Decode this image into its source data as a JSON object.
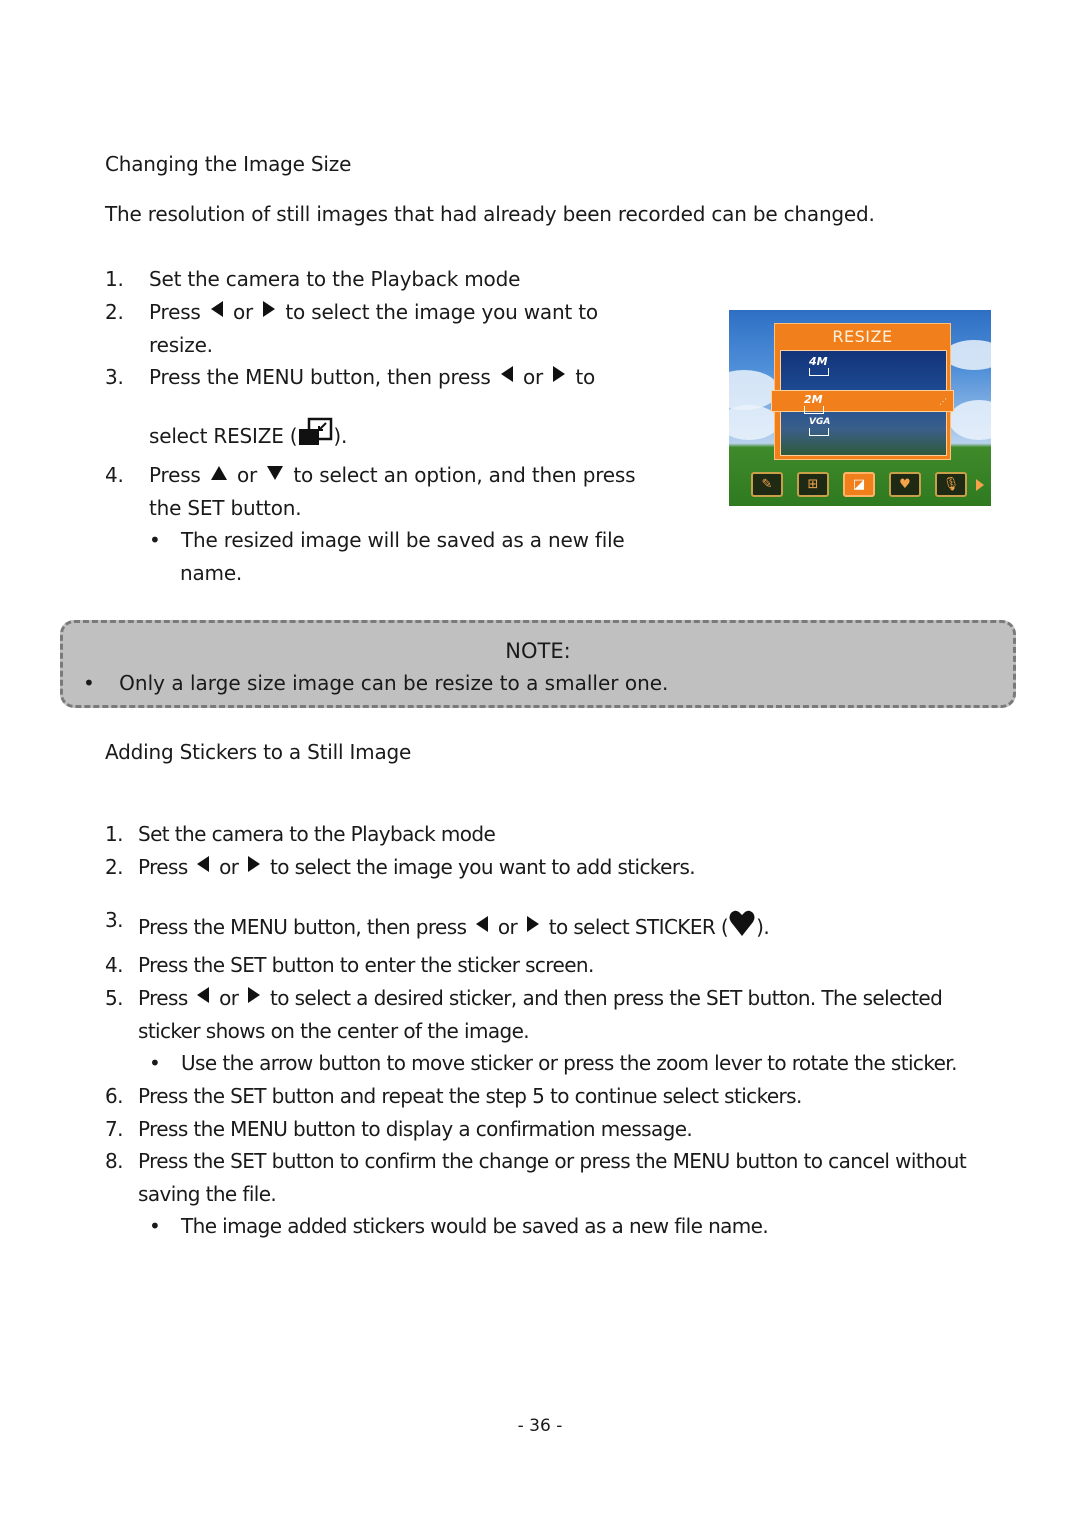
{
  "section1": {
    "heading": "Changing the Image Size",
    "intro": "The resolution of still images that had already been recorded can be changed.",
    "steps": [
      {
        "num": "1.",
        "text": "Set the camera to the Playback mode"
      },
      {
        "num": "2.",
        "pre": "Press",
        "or": "or",
        "post": "to select the image you want to",
        "cont": "resize."
      },
      {
        "num": "3.",
        "pre": "Press the MENU button, then press",
        "or": "or",
        "post": "to",
        "cont_pre": "select RESIZE (",
        "cont_post": ")."
      },
      {
        "num": "4.",
        "pre": "Press",
        "or": "or",
        "post": "to select an option, and then press",
        "cont": "the SET button."
      }
    ],
    "bullet": {
      "symbol": "•",
      "line1": "The resized image will be saved as a new file",
      "line2": "name."
    }
  },
  "camera_screen": {
    "menu_title": "RESIZE",
    "options": [
      "4M",
      "2M",
      "VGA"
    ],
    "selected_option": "2M",
    "icons": [
      "effect-icon",
      "rotate-icon",
      "resize-icon",
      "sticker-icon",
      "voice-memo-icon"
    ],
    "selected_icon": "resize-icon",
    "accent_color": "#f07f1c"
  },
  "note": {
    "title": "NOTE:",
    "bullet": "•",
    "text": "Only a large size image can be resize to a smaller one."
  },
  "section2": {
    "heading": "Adding Stickers to a Still Image",
    "steps": [
      {
        "num": "1.",
        "text": "Set the camera to the Playback mode"
      },
      {
        "num": "2.",
        "pre": "Press",
        "or": "or",
        "post": "to select the image you want to add stickers."
      },
      {
        "num": "3.",
        "pre": "Press the MENU button, then press",
        "or": "or",
        "post": "to select STICKER (",
        "end": ")."
      },
      {
        "num": "4.",
        "text": "Press the SET button to enter the sticker screen."
      },
      {
        "num": "5.",
        "pre": "Press",
        "or": "or",
        "post": "to select a desired sticker, and then press the SET button. The selected",
        "cont": "sticker shows on the center of the image."
      },
      {
        "num": "6.",
        "text": "Press the SET button and repeat the step 5 to continue select stickers."
      },
      {
        "num": "7.",
        "text": "Press the MENU button to display a confirmation message."
      },
      {
        "num": "8.",
        "text": "Press the SET button to confirm the change or press the MENU button to cancel without",
        "cont": "saving the file."
      }
    ],
    "bullet5": "Use the arrow button to move sticker or press the zoom lever to rotate the sticker.",
    "bullet8": "The image added stickers would be saved as a new file name.",
    "bullet_symbol": "•"
  },
  "footer": {
    "page_number": "- 36 -"
  }
}
